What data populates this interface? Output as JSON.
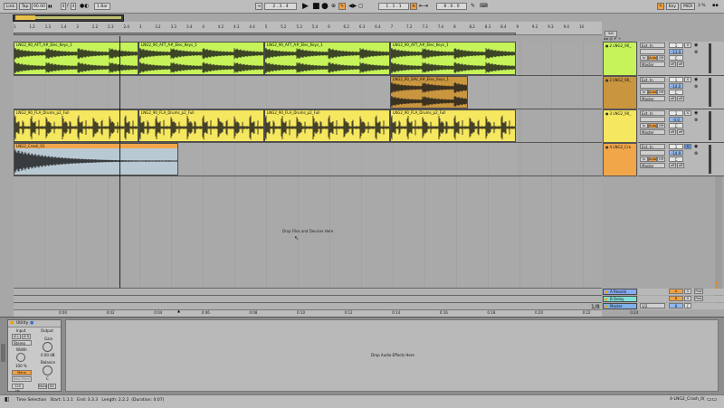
{
  "transport": {
    "link": "Link",
    "tap": "Tap",
    "tempo": "90.00",
    "sig_num": "4",
    "sig_den": "4",
    "quant": "1 Bar",
    "position": "2 . 3 . 4",
    "loop_start": "1 . 1 . 1",
    "loop_len": "8 . 0 . 0",
    "key": "Key",
    "midi": "MIDI",
    "cpu": "3 %"
  },
  "ruler": {
    "markers": [
      "1",
      "1.2",
      "1.3",
      "1.4",
      "2",
      "2.2",
      "2.3",
      "2.4",
      "3",
      "3.2",
      "3.3",
      "3.4",
      "4",
      "4.2",
      "4.3",
      "4.4",
      "5",
      "5.2",
      "5.3",
      "5.4",
      "6",
      "6.2",
      "6.3",
      "6.4",
      "7",
      "7.2",
      "7.3",
      "7.4",
      "8",
      "8.2",
      "8.3",
      "8.4",
      "9",
      "9.2",
      "9.3",
      "9.4",
      "10"
    ],
    "time": [
      "0:00",
      "0:02",
      "0:04",
      "0:06",
      "0:08",
      "0:10",
      "0:12",
      "0:14",
      "0:16",
      "0:18",
      "0:20",
      "0:22",
      "0:24"
    ],
    "page": "1/8"
  },
  "tracks": [
    {
      "name": "2 LNG2_90_",
      "color": "#c6f25a",
      "clips": [
        {
          "label": "LNG2_90_AFT_A#_Elec_Keys_1"
        },
        {
          "label": "LNG2_90_AFT_A#_Elec_Keys_1"
        },
        {
          "label": "LNG2_90_AFT_A#_Elec_Keys_1"
        },
        {
          "label": "LNG2_90_AFT_A#_Elec_Keys_1"
        }
      ],
      "input": "Ext. In",
      "ch": "1",
      "routing": "Master",
      "vol": "-13.0",
      "pan": "C",
      "sends": [
        "S",
        "off",
        "off"
      ]
    },
    {
      "name": "2 LNG2_90_",
      "color": "#c9953f",
      "clips": [
        {
          "label": "LNG2_90_SAV_A#_Elec_Keys_1"
        }
      ],
      "input": "Ext. In",
      "ch": "1",
      "routing": "Master",
      "vol": "-14.0",
      "pan": "C",
      "sends": [
        "S",
        "off",
        "off"
      ]
    },
    {
      "name": "3 LNG2_90_",
      "color": "#f5e75f",
      "clips": [
        {
          "label": "LNG2_90_FLA_Drums_p2_Full"
        },
        {
          "label": "LNG2_90_FLA_Drums_p2_Full"
        },
        {
          "label": "LNG2_90_FLA_Drums_p2_Full"
        },
        {
          "label": "LNG2_90_FLA_Drums_p2_Full"
        }
      ],
      "input": "Ext. In",
      "ch": "1",
      "routing": "Master",
      "vol": "-4.0",
      "pan": "C",
      "sends": [
        "S",
        "off",
        "off"
      ]
    },
    {
      "name": "4 LNG2_Cra",
      "color": "#f2a64a",
      "clips": [
        {
          "label": "LNG2_Crash_01"
        }
      ],
      "input": "Ext. In",
      "ch": "1",
      "routing": "Master",
      "vol": "-14.9",
      "pan": "C",
      "sends": [
        "S",
        "off",
        "off"
      ]
    }
  ],
  "drop_hint": "Drop Files and Devices Here",
  "returns": [
    {
      "name": "A Reverb",
      "letter": "A",
      "color": "#86aaf0"
    },
    {
      "name": "B Delay",
      "letter": "B",
      "color": "#7fe0d8"
    },
    {
      "name": "Master",
      "letter": "M",
      "color": "#7fb0e8"
    }
  ],
  "master_out": "1/2",
  "device": {
    "title": "Utility",
    "input": "Input",
    "output": "Output",
    "mode": "Stereo",
    "width_label": "Width",
    "width_value": "100 %",
    "mono": "Mono",
    "bass_mono": "Bass Mono",
    "gain_label": "Gain",
    "gain_value": "0.00 dB",
    "balance_label": "Balance",
    "balance_value": "C",
    "mute": "Mute",
    "dc": "DC",
    "hz": "120 Hz",
    "effects_hint": "Drop Audio Effects Here"
  },
  "status": {
    "selection": "Time Selection",
    "start": "Start: 1.1.1",
    "end": "End: 3.3.3",
    "length": "Length: 2.2.2",
    "duration": "(Duration: 0:07)",
    "track": "4-LNG2_Crash_0("
  }
}
